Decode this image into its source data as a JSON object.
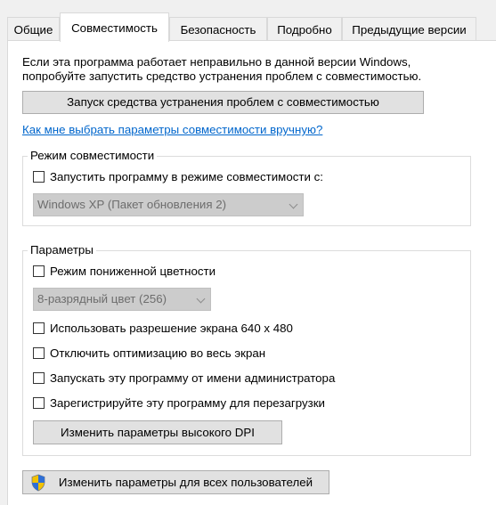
{
  "tabs": [
    {
      "label": "Общие",
      "active": false
    },
    {
      "label": "Совместимость",
      "active": true
    },
    {
      "label": "Безопасность",
      "active": false
    },
    {
      "label": "Подробно",
      "active": false
    },
    {
      "label": "Предыдущие версии",
      "active": false
    }
  ],
  "intro": {
    "line1": "Если эта программа работает неправильно в данной версии Windows,",
    "line2": "попробуйте запустить средство устранения проблем с совместимостью."
  },
  "troubleshooter_button": "Запуск средства устранения проблем с совместимостью",
  "help_link": "Как мне выбрать параметры совместимости вручную?",
  "compat_mode": {
    "title": "Режим совместимости",
    "checkbox_label": "Запустить программу в режиме совместимости с:",
    "checked": false,
    "select_value": "Windows XP (Пакет обновления 2)"
  },
  "settings": {
    "title": "Параметры",
    "reduced_color": {
      "label": "Режим пониженной цветности",
      "checked": false
    },
    "color_select_value": "8-разрядный цвет (256)",
    "resolution_640": {
      "label": "Использовать разрешение экрана 640 x 480",
      "checked": false
    },
    "disable_fullscreen": {
      "label": "Отключить оптимизацию во весь экран",
      "checked": false
    },
    "run_as_admin": {
      "label": "Запускать эту программу от имени администратора",
      "checked": false
    },
    "register_restart": {
      "label": "Зарегистрируйте эту программу для перезагрузки",
      "checked": false
    },
    "dpi_button": "Изменить параметры высокого DPI"
  },
  "all_users_button": "Изменить параметры для всех пользователей",
  "colors": {
    "link": "#0066cc",
    "panel": "#ffffff",
    "window": "#f0f0f0",
    "button": "#e1e1e1"
  }
}
